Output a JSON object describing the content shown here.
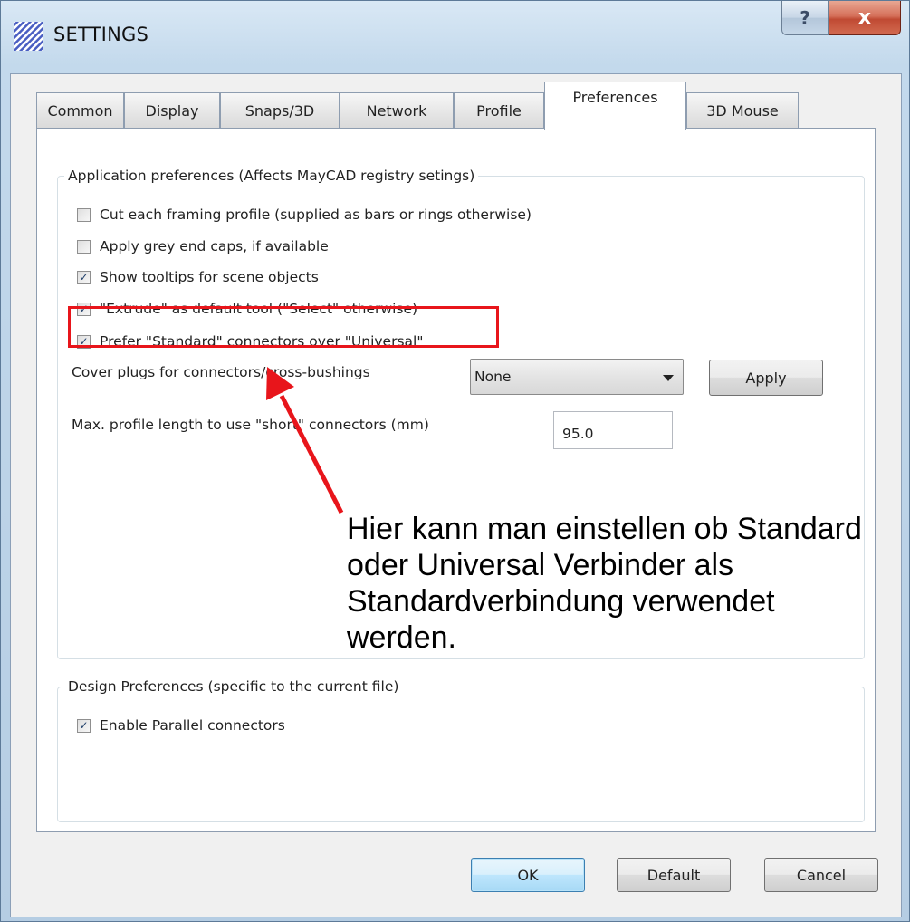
{
  "window": {
    "title": "SETTINGS",
    "help_label": "?",
    "close_label": "x"
  },
  "tabs": [
    {
      "label": "Common"
    },
    {
      "label": "Display"
    },
    {
      "label": "Snaps/3D"
    },
    {
      "label": "Network"
    },
    {
      "label": "Profile"
    },
    {
      "label": "Preferences",
      "active": true
    },
    {
      "label": "3D Mouse"
    }
  ],
  "app_prefs": {
    "title": "Application preferences (Affects MayCAD registry setings)",
    "options": [
      {
        "label": "Cut each framing profile (supplied as bars or rings otherwise)",
        "checked": false
      },
      {
        "label": "Apply grey end caps, if available",
        "checked": false
      },
      {
        "label": "Show tooltips for scene objects",
        "checked": true
      },
      {
        "label": "\"Extrude\" as default tool (\"Select\" otherwise)",
        "checked": true
      },
      {
        "label": "Prefer \"Standard\" connectors over \"Universal\"",
        "checked": true
      }
    ],
    "cover_plugs_label": "Cover plugs for connectors/cross-bushings",
    "cover_plugs_value": "None",
    "apply_label": "Apply",
    "max_length_label": "Max. profile length to use \"short\" connectors (mm)",
    "max_length_value": "95.0"
  },
  "design_prefs": {
    "title": "Design Preferences (specific to the current file)",
    "options": [
      {
        "label": "Enable Parallel connectors",
        "checked": true
      }
    ]
  },
  "annotation": {
    "text": "Hier kann man einstellen ob Standard oder Universal Verbinder als Standardverbindung verwendet werden.",
    "color": "#e8151b"
  },
  "buttons": {
    "ok": "OK",
    "default": "Default",
    "cancel": "Cancel"
  },
  "check_glyph": "✓"
}
